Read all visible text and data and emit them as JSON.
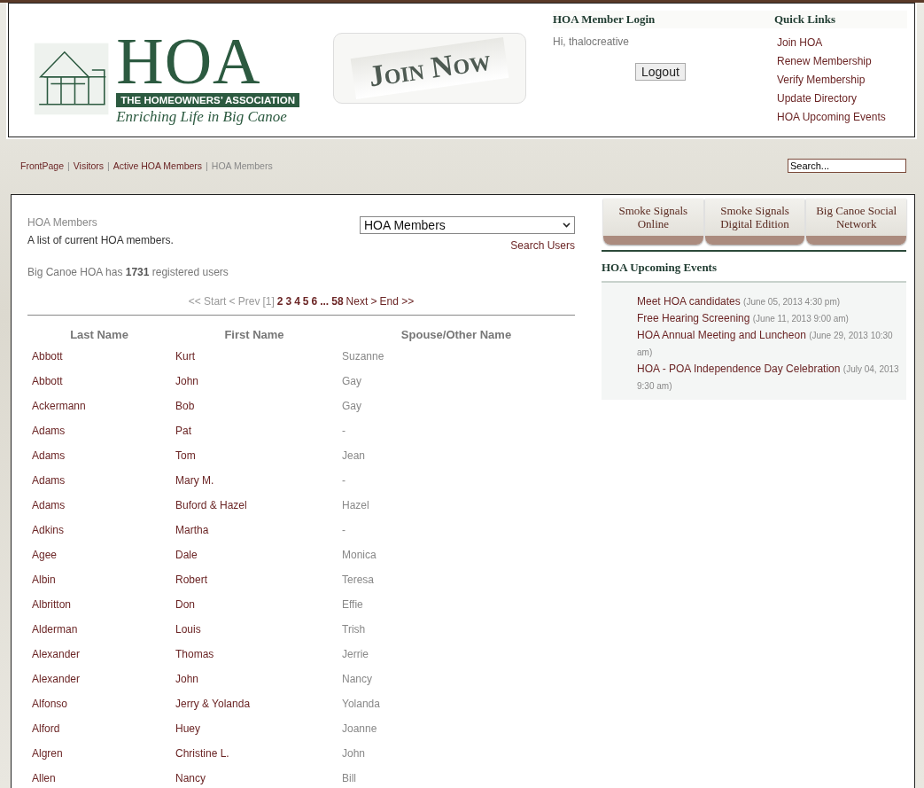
{
  "header": {
    "logo": {
      "title": "HOA",
      "banner": "THE HOMEOWNERS’ ASSOCIATION",
      "tagline": "Enriching Life in Big Canoe"
    },
    "join_button": "Join Now",
    "login": {
      "heading": "HOA Member Login",
      "greeting": "Hi, thalocreative",
      "button": "Logout"
    },
    "quick_links": {
      "heading": "Quick Links",
      "items": [
        "Join HOA",
        "Renew Membership",
        "Verify Membership",
        "Update Directory",
        "HOA Upcoming Events"
      ]
    }
  },
  "breadcrumb": {
    "separator": "|",
    "items": [
      {
        "label": "FrontPage",
        "selected": false
      },
      {
        "label": "Visitors",
        "selected": false
      },
      {
        "label": "Active HOA Members",
        "selected": false
      },
      {
        "label": "HOA Members",
        "selected": true
      }
    ]
  },
  "search": {
    "placeholder": "Search..."
  },
  "members": {
    "title": "HOA Members",
    "description": "A list of current HOA members.",
    "group_select": "HOA Members",
    "search_link": "Search Users",
    "count_text": "Big Canoe HOA has **1731** registered users",
    "pager": [
      {
        "label": "<< Start",
        "kind": "disabled"
      },
      {
        "label": "< Prev",
        "kind": "disabled"
      },
      {
        "label": "[1]",
        "kind": "current"
      },
      {
        "label": "2",
        "kind": "page"
      },
      {
        "label": "3",
        "kind": "page"
      },
      {
        "label": "4",
        "kind": "page"
      },
      {
        "label": "5",
        "kind": "page"
      },
      {
        "label": "6",
        "kind": "page"
      },
      {
        "label": "...",
        "kind": "page"
      },
      {
        "label": "58",
        "kind": "page"
      },
      {
        "label": "Next >",
        "kind": "link"
      },
      {
        "label": "End >>",
        "kind": "link"
      }
    ],
    "columns": [
      "Last Name",
      "First Name",
      "Spouse/Other Name"
    ],
    "rows": [
      [
        "Abbott",
        "Kurt",
        "Suzanne"
      ],
      [
        "Abbott",
        "John",
        "Gay"
      ],
      [
        "Ackermann",
        "Bob",
        "Gay"
      ],
      [
        "Adams",
        "Pat",
        "-"
      ],
      [
        "Adams",
        "Tom",
        "Jean"
      ],
      [
        "Adams",
        "Mary M.",
        "-"
      ],
      [
        "Adams",
        "Buford & Hazel",
        "Hazel"
      ],
      [
        "Adkins",
        "Martha",
        "-"
      ],
      [
        "Agee",
        "Dale",
        "Monica"
      ],
      [
        "Albin",
        "Robert",
        "Teresa"
      ],
      [
        "Albritton",
        "Don",
        "Effie"
      ],
      [
        "Alderman",
        "Louis",
        "Trish"
      ],
      [
        "Alexander",
        "Thomas",
        "Jerrie"
      ],
      [
        "Alexander",
        "John",
        "Nancy"
      ],
      [
        "Alfonso",
        "Jerry & Yolanda",
        "Yolanda"
      ],
      [
        "Alford",
        "Huey",
        "Joanne"
      ],
      [
        "Algren",
        "Christine L.",
        "John"
      ],
      [
        "Allen",
        "Nancy",
        "Bill"
      ]
    ]
  },
  "sidebar": {
    "tabs": [
      "Smoke Signals Online",
      "Smoke Signals Digital Edition",
      "Big Canoe Social Network"
    ],
    "events_heading": "HOA Upcoming Events",
    "events": [
      {
        "title": "Meet HOA candidates",
        "date": "(June 05, 2013 4:30 pm)"
      },
      {
        "title": "Free Hearing Screening",
        "date": "(June 11, 2013 9:00 am)"
      },
      {
        "title": "HOA Annual Meeting and Luncheon",
        "date": "(June 29, 2013 10:30 am)"
      },
      {
        "title": "HOA - POA Independence Day Celebration",
        "date": "(July 04, 2013 9:30 am)"
      }
    ]
  }
}
